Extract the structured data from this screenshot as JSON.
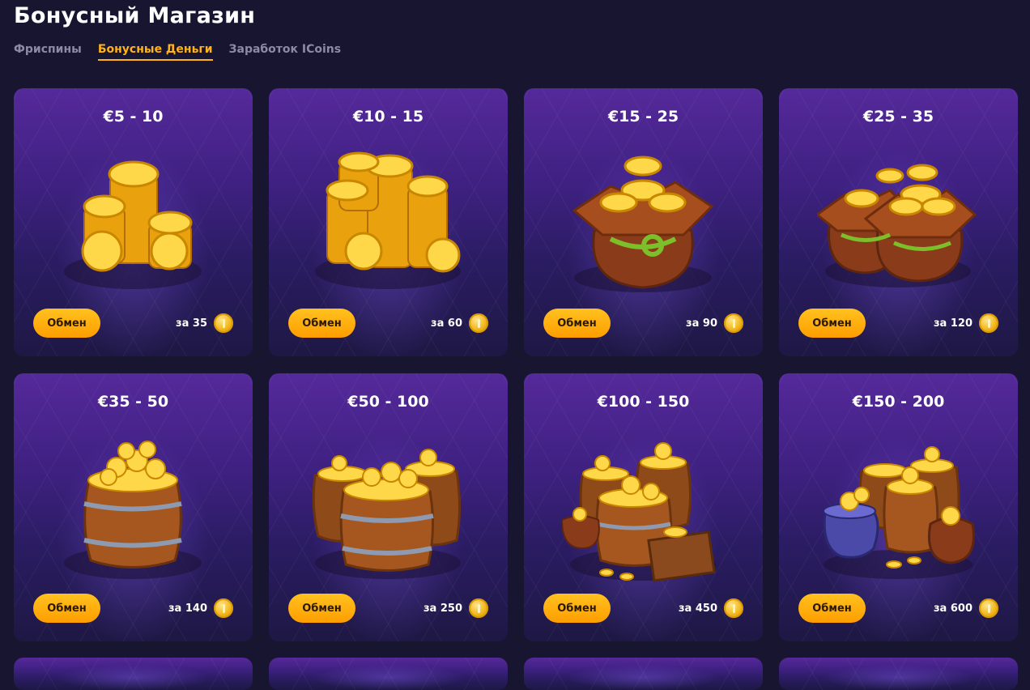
{
  "page": {
    "title": "Бонусный Магазин"
  },
  "tabs": [
    {
      "label": "Фриспины",
      "active": false
    },
    {
      "label": "Бонусные Деньги",
      "active": true
    },
    {
      "label": "Заработок ICoins",
      "active": false
    }
  ],
  "exchange_label": "Обмен",
  "products": [
    {
      "title": "€5 - 10",
      "price": "за 35",
      "art": "coin-stack-icon"
    },
    {
      "title": "€10 - 15",
      "price": "за 60",
      "art": "coin-pile-icon"
    },
    {
      "title": "€15 - 25",
      "price": "за 90",
      "art": "coin-sack-icon"
    },
    {
      "title": "€25 - 35",
      "price": "за 120",
      "art": "coin-sacks-icon"
    },
    {
      "title": "€35 - 50",
      "price": "за 140",
      "art": "coin-barrel-icon"
    },
    {
      "title": "€50 - 100",
      "price": "за 250",
      "art": "coin-barrels-icon"
    },
    {
      "title": "€100 - 150",
      "price": "за 450",
      "art": "treasure-crate-icon"
    },
    {
      "title": "€150 - 200",
      "price": "за 600",
      "art": "treasure-cauldron-icon"
    }
  ],
  "colors": {
    "background": "#181530",
    "accent": "#ffb21a",
    "card_top": "#55299a"
  }
}
